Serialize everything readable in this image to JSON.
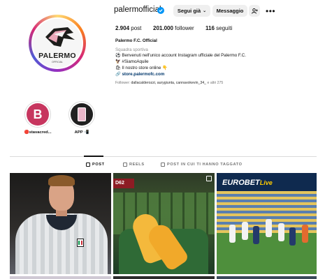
{
  "profile": {
    "username": "palermofficial",
    "verified": true,
    "follow_button": "Segui già",
    "message_button": "Messaggio",
    "avatar_logo_text": "PALERMO",
    "avatar_logo_sub": "OFFICIAL"
  },
  "stats": {
    "posts_count": "2.904",
    "posts_label": "post",
    "followers_count": "201.000",
    "followers_label": "follower",
    "following_count": "116",
    "following_label": "seguiti"
  },
  "bio": {
    "name": "Palermo F.C. Official",
    "category": "Squadra sportiva",
    "line1": "⚽ Benvenuti nell'unico account Instagram ufficiale del Palermo F.C.",
    "line2": "🦅 #SiamoAquile",
    "line3": "🛍 Il nostro store online 👇",
    "link": "store.palermofc.com",
    "followed_by_prefix": "Follower:",
    "followed_by_names": "dallacalderozzi, aurygiunta, cannavokevin_34_",
    "followed_by_suffix": "e altri 275"
  },
  "highlights": [
    {
      "label": "🔴stavacred...",
      "letter": "B"
    },
    {
      "label": "APP 📲"
    }
  ],
  "tabs": [
    {
      "label": "POST",
      "active": true
    },
    {
      "label": "REELS",
      "active": false
    },
    {
      "label": "POST IN CUI TI HANNO TAGGATO",
      "active": false
    }
  ],
  "grid": [
    {
      "kind": "player-photo"
    },
    {
      "kind": "shoes-photo",
      "corner_text": "D62"
    },
    {
      "kind": "match-photo",
      "brand": "EUROBET",
      "brand_suffix": "Live"
    }
  ],
  "colors": {
    "link": "#00376b",
    "muted": "#737373",
    "button_bg": "#efefef",
    "verified": "#0095f6"
  }
}
